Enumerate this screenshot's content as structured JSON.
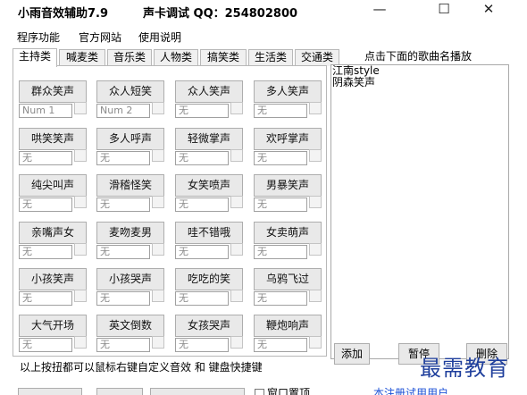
{
  "window": {
    "title": "小雨音效辅助7.9",
    "subtitle": "声卡调试 QQ：254802800",
    "controls": [
      "—",
      "☐",
      "✕"
    ]
  },
  "menu": [
    "程序功能",
    "官方网站",
    "使用说明"
  ],
  "tabs": [
    "主持类",
    "喊麦类",
    "音乐类",
    "人物类",
    "搞笑类",
    "生活类",
    "交通类"
  ],
  "active_tab": "主持类",
  "sound_buttons": [
    {
      "label": "群众笑声",
      "key": "Num 1"
    },
    {
      "label": "众人短笑",
      "key": "Num 2"
    },
    {
      "label": "众人笑声",
      "key": "无"
    },
    {
      "label": "多人笑声",
      "key": "无"
    },
    {
      "label": "哄笑笑声",
      "key": "无"
    },
    {
      "label": "多人呼声",
      "key": "无"
    },
    {
      "label": "轻微掌声",
      "key": "无"
    },
    {
      "label": "欢呼掌声",
      "key": "无"
    },
    {
      "label": "纯尖叫声",
      "key": "无"
    },
    {
      "label": "滑稽怪笑",
      "key": "无"
    },
    {
      "label": "女笑喷声",
      "key": "无"
    },
    {
      "label": "男暴笑声",
      "key": "无"
    },
    {
      "label": "亲嘴声女",
      "key": "无"
    },
    {
      "label": "麦吻麦男",
      "key": "无"
    },
    {
      "label": "哇不错哦",
      "key": "无"
    },
    {
      "label": "女卖萌声",
      "key": "无"
    },
    {
      "label": "小孩笑声",
      "key": "无"
    },
    {
      "label": "小孩哭声",
      "key": "无"
    },
    {
      "label": "吃吃的笑",
      "key": "无"
    },
    {
      "label": "乌鸦飞过",
      "key": "无"
    },
    {
      "label": "大气开场",
      "key": "无"
    },
    {
      "label": "英文倒数",
      "key": "无"
    },
    {
      "label": "女孩哭声",
      "key": "无"
    },
    {
      "label": "鞭炮响声",
      "key": "无"
    }
  ],
  "song_panel": {
    "header": "点击下面的歌曲名播放",
    "songs": [
      "江南style",
      "阴森笑声"
    ],
    "add_label": "添加",
    "pause_label": "暂停",
    "delete_label": "删除"
  },
  "hint": "以上按扭都可以鼠标右键自定义音效 和 键盘快捷键",
  "bottom": {
    "checkbox_label": "窗口置顶",
    "link_text": "本注册试用用户"
  },
  "watermark": "最需教育"
}
